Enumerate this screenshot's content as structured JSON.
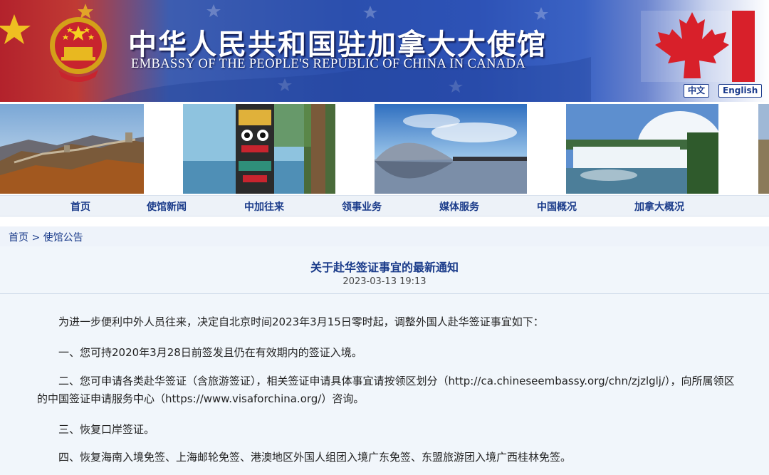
{
  "header": {
    "title_cn": "中华人民共和国驻加拿大大使馆",
    "title_en": "EMBASSY OF THE PEOPLE'S REPUBLIC OF CHINA IN CANADA",
    "lang_cn": "中文",
    "lang_en": "English"
  },
  "photos": [
    "great-wall",
    "totem-pole",
    "national-grand-theatre",
    "niagara-falls"
  ],
  "nav": {
    "items": [
      "首页",
      "使馆新闻",
      "中加往来",
      "领事业务",
      "媒体服务",
      "中国概况",
      "加拿大概况"
    ]
  },
  "breadcrumb": {
    "home": "首页",
    "separator": " > ",
    "current": "使馆公告"
  },
  "article": {
    "title": "关于赴华签证事宜的最新通知",
    "date": "2023-03-13 19:13",
    "paragraphs": [
      "为进一步便利中外人员往来，决定自北京时间2023年3月15日零时起，调整外国人赴华签证事宜如下：",
      "一、您可持2020年3月28日前签发且仍在有效期内的签证入境。",
      "二、您可申请各类赴华签证（含旅游签证），相关签证申请具体事宜请按领区划分（http://ca.chineseembassy.org/chn/zjzlglj/），向所属领区的中国签证申请服务中心（https://www.visaforchina.org/）咨询。",
      "三、恢复口岸签证。",
      "四、恢复海南入境免签、上海邮轮免签、港澳地区外国人组团入境广东免签、东盟旅游团入境广西桂林免签。"
    ]
  },
  "colors": {
    "brand_blue": "#2b4fae",
    "brand_red": "#c8242e",
    "nav_text": "#1a3b8a"
  }
}
